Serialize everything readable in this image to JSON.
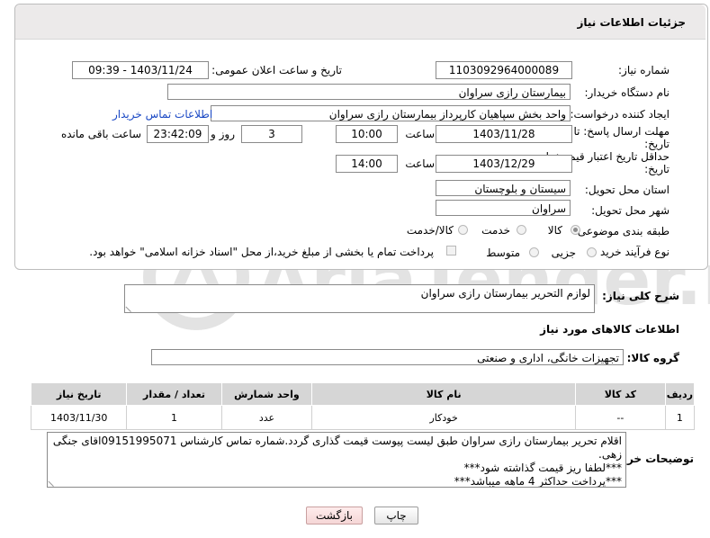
{
  "header": {
    "title": "جزئیات اطلاعات نیاز"
  },
  "form": {
    "need_number_label": "شماره نیاز:",
    "need_number": "1103092964000089",
    "announce_label": "تاریخ و ساعت اعلان عمومی:",
    "announce_value": "1403/11/24 - 09:39",
    "buyer_org_label": "نام دستگاه خریدار:",
    "buyer_org": "بیمارستان رازی سراوان",
    "requester_label": "ایجاد کننده درخواست:",
    "requester": "واحد بخش  سپاهیان کارپرداز بیمارستان رازی سراوان",
    "contact_link": "اطلاعات تماس خریدار",
    "deadline_label_1": "مهلت ارسال پاسخ: تا",
    "deadline_label_2": "تاریخ:",
    "deadline_date": "1403/11/28",
    "time_label": "ساعت",
    "deadline_time": "10:00",
    "days_value": "3",
    "days_label": "روز و",
    "remaining_time": "23:42:09",
    "remaining_label": "ساعت باقی مانده",
    "validity_label_1": "حداقل تاریخ اعتبار قیمت: تا",
    "validity_label_2": "تاریخ:",
    "validity_date": "1403/12/29",
    "validity_time_label": "ساعت",
    "validity_time": "14:00",
    "province_label": "استان محل تحویل:",
    "province": "سیستان و بلوچستان",
    "city_label": "شهر محل تحویل:",
    "city": "سراوان",
    "category_label": "طبقه بندی موضوعی:",
    "category_options": [
      "کالا",
      "خدمت",
      "کالا/خدمت"
    ],
    "process_label": "نوع فرآیند خرید :",
    "process_options": [
      "جزیی",
      "متوسط"
    ],
    "process_note": "پرداخت تمام یا بخشی از مبلغ خرید،از محل \"اسناد خزانه اسلامی\" خواهد بود."
  },
  "description": {
    "label": "شرح کلی نیاز:",
    "value": "لوازم التحریر بیمارستان رازی سراوان"
  },
  "goods_info_title": "اطلاعات کالاهای مورد نیاز",
  "goods_group": {
    "label": "گروه کالا:",
    "value": "تجهیزات خانگی، اداری و صنعتی"
  },
  "table": {
    "headers": [
      "ردیف",
      "کد کالا",
      "نام کالا",
      "واحد شمارش",
      "تعداد / مقدار",
      "تاریخ نیاز"
    ],
    "rows": [
      [
        "1",
        "--",
        "خودکار",
        "عدد",
        "1",
        "1403/11/30"
      ]
    ]
  },
  "buyer_notes": {
    "label": "توضیحات خریدار:",
    "line1": "اقلام تحریر بیمارستان رازی سراوان طبق لیست پیوست قیمت گذاری گردد.شماره تماس کارشناس 09151995071اقای جنگی",
    "line2": "زهی.",
    "line3": "***لطفا ریز قیمت گذاشته شود***",
    "line4": "***پرداخت حداکثر 4 ماهه میباشد***"
  },
  "buttons": {
    "print": "چاپ",
    "back": "بازگشت"
  },
  "watermark_text": "AriaTender.net"
}
